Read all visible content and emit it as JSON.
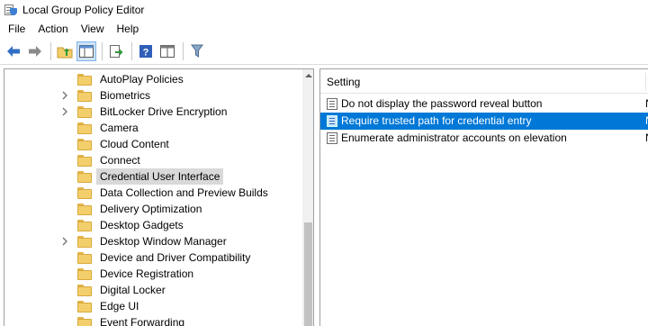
{
  "window": {
    "title": "Local Group Policy Editor"
  },
  "menu": [
    "File",
    "Action",
    "View",
    "Help"
  ],
  "toolbar": {
    "buttons": [
      "back-arrow-icon",
      "forward-arrow-icon",
      "up-folder-icon",
      "show-hide-tree-icon",
      "export-list-icon",
      "help-icon",
      "properties-view-icon",
      "filter-icon"
    ]
  },
  "tree": {
    "items": [
      {
        "label": "AutoPlay Policies",
        "expandable": false,
        "selected": false
      },
      {
        "label": "Biometrics",
        "expandable": true,
        "selected": false
      },
      {
        "label": "BitLocker Drive Encryption",
        "expandable": true,
        "selected": false
      },
      {
        "label": "Camera",
        "expandable": false,
        "selected": false
      },
      {
        "label": "Cloud Content",
        "expandable": false,
        "selected": false
      },
      {
        "label": "Connect",
        "expandable": false,
        "selected": false
      },
      {
        "label": "Credential User Interface",
        "expandable": false,
        "selected": true
      },
      {
        "label": "Data Collection and Preview Builds",
        "expandable": false,
        "selected": false
      },
      {
        "label": "Delivery Optimization",
        "expandable": false,
        "selected": false
      },
      {
        "label": "Desktop Gadgets",
        "expandable": false,
        "selected": false
      },
      {
        "label": "Desktop Window Manager",
        "expandable": true,
        "selected": false
      },
      {
        "label": "Device and Driver Compatibility",
        "expandable": false,
        "selected": false
      },
      {
        "label": "Device Registration",
        "expandable": false,
        "selected": false
      },
      {
        "label": "Digital Locker",
        "expandable": false,
        "selected": false
      },
      {
        "label": "Edge UI",
        "expandable": false,
        "selected": false
      },
      {
        "label": "Event Forwarding",
        "expandable": false,
        "selected": false
      }
    ]
  },
  "settings": {
    "column_header": "Setting",
    "rows": [
      {
        "name": "Do not display the password reveal button",
        "state": "N",
        "selected": false
      },
      {
        "name": "Require trusted path for credential entry",
        "state": "N",
        "selected": true
      },
      {
        "name": "Enumerate administrator accounts on elevation",
        "state": "N",
        "selected": false
      }
    ]
  },
  "colors": {
    "selection_blue": "#0078d7",
    "tree_selection": "#d9d9d9",
    "folder_yellow": "#f3cf6c"
  }
}
